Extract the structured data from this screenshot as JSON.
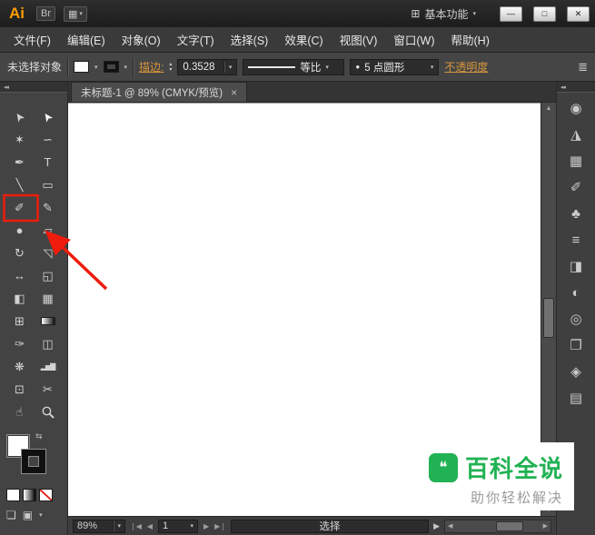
{
  "titlebar": {
    "logo": "Ai",
    "bridge_label": "Br",
    "workspace_label": "基本功能",
    "window": {
      "minimize": "—",
      "maximize": "□",
      "close": "✕"
    }
  },
  "menubar": {
    "items": [
      "文件(F)",
      "编辑(E)",
      "对象(O)",
      "文字(T)",
      "选择(S)",
      "效果(C)",
      "视图(V)",
      "窗口(W)",
      "帮助(H)"
    ]
  },
  "controlbar": {
    "selection_status": "未选择对象",
    "stroke_label": "描边:",
    "stroke_weight": "0.3528",
    "profile_name": "等比",
    "brush_name": "5 点圆形",
    "opacity_label": "不透明度"
  },
  "document": {
    "tab_title": "未标题-1 @ 89% (CMYK/预览)",
    "close": "×"
  },
  "toolbar": {
    "tools": [
      {
        "name": "selection",
        "glyph": "➤"
      },
      {
        "name": "direct-selection",
        "glyph": "➤"
      },
      {
        "name": "magic-wand",
        "glyph": "✶"
      },
      {
        "name": "lasso",
        "glyph": "∽"
      },
      {
        "name": "pen",
        "glyph": "✒"
      },
      {
        "name": "type",
        "glyph": "T"
      },
      {
        "name": "line-segment",
        "glyph": "╲"
      },
      {
        "name": "rectangle",
        "glyph": "▭"
      },
      {
        "name": "paintbrush",
        "glyph": "✐"
      },
      {
        "name": "pencil",
        "glyph": "✎"
      },
      {
        "name": "blob-brush",
        "glyph": "●"
      },
      {
        "name": "eraser",
        "glyph": "▱"
      },
      {
        "name": "rotate",
        "glyph": "↻"
      },
      {
        "name": "scale",
        "glyph": "◹"
      },
      {
        "name": "width",
        "glyph": "↔"
      },
      {
        "name": "free-transform",
        "glyph": "◱"
      },
      {
        "name": "shape-builder",
        "glyph": "◧"
      },
      {
        "name": "perspective-grid",
        "glyph": "▦"
      },
      {
        "name": "mesh",
        "glyph": "⊞"
      },
      {
        "name": "gradient",
        "glyph": ""
      },
      {
        "name": "eyedropper",
        "glyph": "✑"
      },
      {
        "name": "blend",
        "glyph": "◫"
      },
      {
        "name": "symbol-sprayer",
        "glyph": "❋"
      },
      {
        "name": "column-graph",
        "glyph": "▂▅▇"
      },
      {
        "name": "artboard",
        "glyph": "⊡"
      },
      {
        "name": "slice",
        "glyph": "✂"
      },
      {
        "name": "hand",
        "glyph": "☝"
      },
      {
        "name": "zoom",
        "glyph": ""
      }
    ]
  },
  "dock": {
    "panels": [
      {
        "name": "color",
        "glyph": "◉"
      },
      {
        "name": "color-guide",
        "glyph": "◮"
      },
      {
        "name": "swatches",
        "glyph": "▦"
      },
      {
        "name": "brushes",
        "glyph": "✐"
      },
      {
        "name": "symbols",
        "glyph": "♣"
      },
      {
        "name": "stroke",
        "glyph": "≡"
      },
      {
        "name": "gradient",
        "glyph": "◨"
      },
      {
        "name": "transparency",
        "glyph": "◐"
      },
      {
        "name": "appearance",
        "glyph": "◎"
      },
      {
        "name": "graphic-styles",
        "glyph": "❐"
      },
      {
        "name": "layers",
        "glyph": "◈"
      },
      {
        "name": "artboards",
        "glyph": "▤"
      }
    ]
  },
  "statusbar": {
    "zoom": "89%",
    "artboard": "1",
    "status": "选择"
  },
  "watermark": {
    "title": "百科全说",
    "subtitle": "助你轻松解决",
    "logo_glyph": "❝"
  },
  "icons": {
    "collapse": "◂◂",
    "dropdown": "▾",
    "stepper_up": "▴",
    "stepper_down": "▾",
    "arrange_documents": "▦",
    "workspace": "⊞",
    "panel_menu": "≣",
    "swap_colors": "⇆",
    "drawing_mode": "❏",
    "screen_mode": "▣",
    "brush_dot": "●",
    "scroll_up": "▲",
    "scroll_down": "▼",
    "scroll_left": "◀",
    "scroll_right": "▶",
    "nav_first": "❘◀",
    "nav_prev": "◀",
    "nav_next": "▶",
    "nav_last": "▶❘",
    "status_expand": "▶"
  },
  "colors": {
    "accent_orange": "#d7953d",
    "annotation_red": "#ed1c0d",
    "watermark_green": "#21b254"
  }
}
